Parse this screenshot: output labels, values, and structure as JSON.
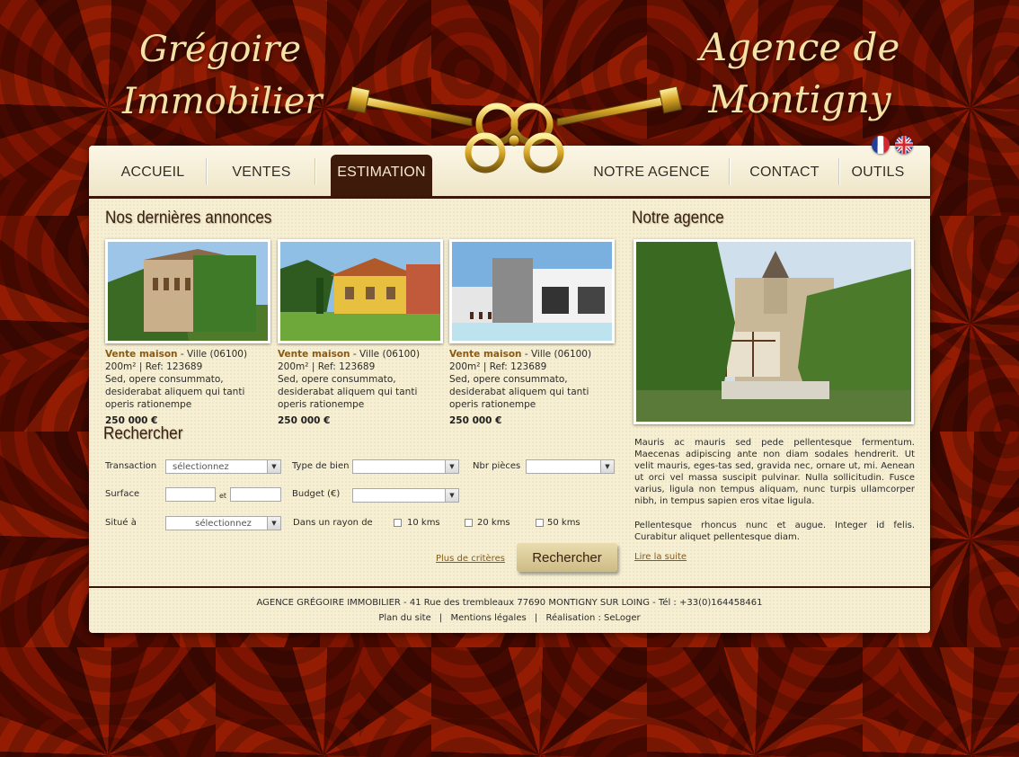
{
  "brand": {
    "left_line1": "Grégoire",
    "left_line2": "Immobilier",
    "right_line1": "Agence de",
    "right_line2": "Montigny"
  },
  "nav": {
    "items": [
      {
        "label": "ACCUEIL"
      },
      {
        "label": "VENTES"
      },
      {
        "label": "ESTIMATION",
        "active": true
      },
      {
        "label": "NOTRE AGENCE"
      },
      {
        "label": "CONTACT"
      },
      {
        "label": "OUTILS"
      }
    ]
  },
  "languages": [
    "fr",
    "en"
  ],
  "listings": {
    "title": "Nos dernières annonces",
    "items": [
      {
        "type": "Vente maison",
        "location": " - Ville (06100)",
        "details": "200m² | Ref: 123689",
        "description": "Sed, opere consummato, desiderabat aliquem qui tanti operis rationempe",
        "price": "250 000 €"
      },
      {
        "type": "Vente maison",
        "location": " - Ville (06100)",
        "details": "200m² | Ref: 123689",
        "description": "Sed, opere consummato, desiderabat aliquem qui tanti operis rationempe",
        "price": "250 000 €"
      },
      {
        "type": "Vente maison",
        "location": " - Ville (06100)",
        "details": "200m² | Ref: 123689",
        "description": "Sed, opere consummato, desiderabat aliquem qui tanti operis rationempe",
        "price": "250 000 €"
      }
    ]
  },
  "search": {
    "title": "Rechercher",
    "transaction_label": "Transaction",
    "transaction_value": "sélectionnez",
    "type_label": "Type de bien",
    "type_value": "",
    "rooms_label": "Nbr pièces",
    "rooms_value": "",
    "surface_label": "Surface",
    "surface_between": "et",
    "budget_label": "Budget (€)",
    "budget_value": "",
    "location_label": "Situé à",
    "location_value": "sélectionnez",
    "radius_label": "Dans un rayon de",
    "radius_options": [
      "10 kms",
      "20 kms",
      "50 kms"
    ],
    "more_criteria": "Plus de critères",
    "button": "Rechercher"
  },
  "agency": {
    "title": "Notre agence",
    "paragraph1": "Mauris ac mauris sed pede pellentesque fermentum. Maecenas adipiscing ante non diam sodales hendrerit. Ut velit mauris, eges-tas sed, gravida nec, ornare ut, mi. Aenean ut orci vel massa suscipit pulvinar. Nulla sollicitudin. Fusce varius, ligula non tempus aliquam, nunc turpis ullamcorper nibh, in tempus sapien eros vitae ligula.",
    "paragraph2": "Pellentesque rhoncus nunc et augue. Integer id felis. Curabitur aliquet pellentesque diam.",
    "read_more": "Lire la suite"
  },
  "footer": {
    "address": "AGENCE GRÉGOIRE IMMOBILIER - 41 Rue des trembleaux 77690 MONTIGNY SUR LOING  - Tél : +33(0)164458461",
    "sitemap": "Plan du site",
    "legal": "Mentions légales",
    "credit": "Réalisation : SeLoger",
    "separator": "|"
  },
  "colors": {
    "dark_brown": "#3d1a0a",
    "gold_text": "#f3e3a6",
    "link_brown": "#8a5a14",
    "panel_bg": "#f6efd3"
  }
}
